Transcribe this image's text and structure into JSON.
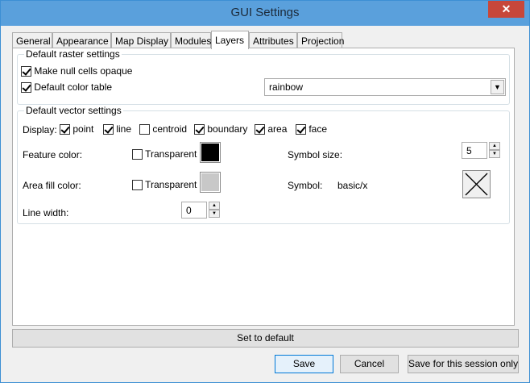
{
  "window": {
    "title": "GUI Settings",
    "close_glyph": "✕"
  },
  "tabs": [
    "General",
    "Appearance",
    "Map Display",
    "Modules",
    "Layers",
    "Attributes",
    "Projection"
  ],
  "active_tab": "Layers",
  "raster": {
    "group_title": "Default raster settings",
    "null_opaque_label": "Make null cells opaque",
    "null_opaque_checked": true,
    "color_table_label": "Default color table",
    "color_table_checked": true,
    "color_table_value": "rainbow"
  },
  "vector": {
    "group_title": "Default vector settings",
    "display_label": "Display:",
    "display_options": [
      {
        "label": "point",
        "checked": true
      },
      {
        "label": "line",
        "checked": true
      },
      {
        "label": "centroid",
        "checked": false
      },
      {
        "label": "boundary",
        "checked": true
      },
      {
        "label": "area",
        "checked": true
      },
      {
        "label": "face",
        "checked": true
      }
    ],
    "feature_color_label": "Feature color:",
    "feature_transparent_label": "Transparent",
    "feature_transparent_checked": false,
    "feature_color": "#000000",
    "area_fill_label": "Area fill color:",
    "area_transparent_label": "Transparent",
    "area_transparent_checked": false,
    "area_fill_color": "#c8c8c8",
    "line_width_label": "Line width:",
    "line_width_value": "0",
    "symbol_size_label": "Symbol size:",
    "symbol_size_value": "5",
    "symbol_label": "Symbol:",
    "symbol_value": "basic/x"
  },
  "buttons": {
    "set_default": "Set to default",
    "save": "Save",
    "cancel": "Cancel",
    "save_session": "Save for this session only"
  }
}
